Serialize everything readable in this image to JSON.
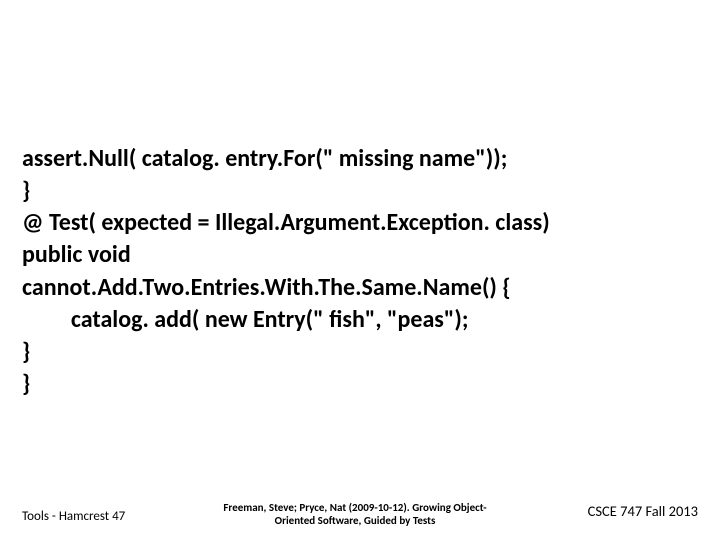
{
  "code": {
    "l1": "assert.Null( catalog. entry.For(\" missing name\"));",
    "l2": "}",
    "l3": "@ Test( expected = Illegal.Argument.Exception. class)",
    "l4": "public void",
    "l5": "cannot.Add.Two.Entries.With.The.Same.Name() {",
    "l6": "         catalog. add( new Entry(\" fish\", \"peas\");",
    "l7": "}",
    "l8": "}"
  },
  "footer": {
    "left": "Tools - Hamcrest  47",
    "center_line1": "Freeman, Steve; Pryce, Nat (2009-10-12). Growing Object-",
    "center_line2": "Oriented Software, Guided by Tests",
    "right": "CSCE 747 Fall 2013"
  }
}
